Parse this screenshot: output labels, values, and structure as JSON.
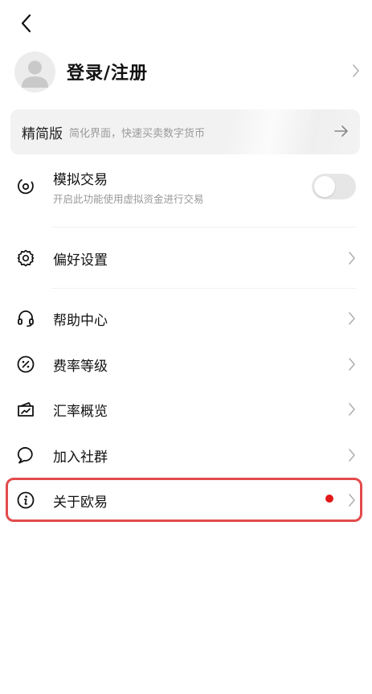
{
  "nav": {
    "back_icon": "chevron-left-icon"
  },
  "profile": {
    "title": "登录/注册",
    "avatar_icon": "user-avatar-icon"
  },
  "lite": {
    "title": "精简版",
    "subtitle": "简化界面，快速买卖数字货币",
    "arrow_icon": "arrow-right-icon"
  },
  "simulated": {
    "label": "模拟交易",
    "desc": "开启此功能使用虚拟资金进行交易",
    "enabled": false,
    "icon": "target-icon"
  },
  "menu": [
    {
      "label": "偏好设置",
      "icon": "gear-icon"
    },
    {
      "label": "帮助中心",
      "icon": "headset-icon"
    },
    {
      "label": "费率等级",
      "icon": "percent-icon"
    },
    {
      "label": "汇率概览",
      "icon": "trend-card-icon"
    },
    {
      "label": "加入社群",
      "icon": "chat-bubble-icon"
    },
    {
      "label": "关于欧易",
      "icon": "info-icon",
      "badge": "red-dot"
    }
  ],
  "colors": {
    "highlight": "#e34b4b",
    "badge": "#e01818"
  }
}
